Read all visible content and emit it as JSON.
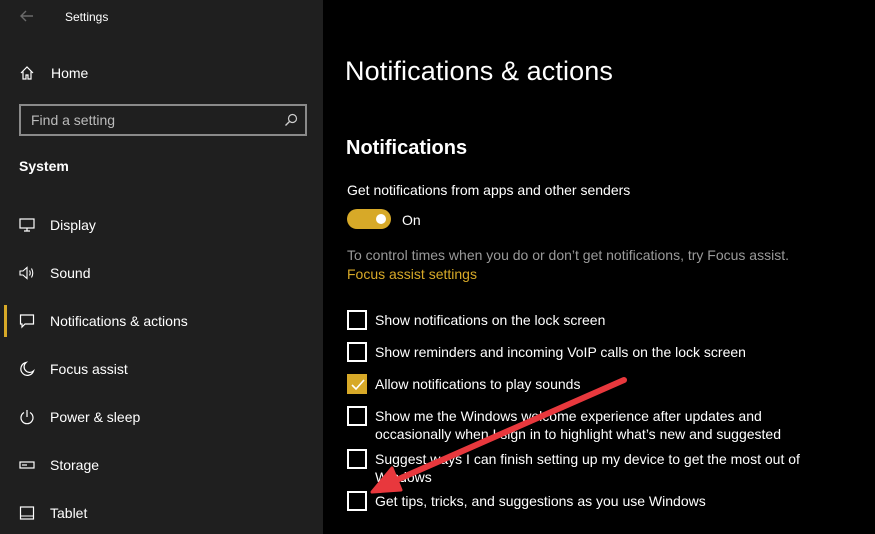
{
  "window": {
    "title": "Settings"
  },
  "sidebar": {
    "home_label": "Home",
    "search_placeholder": "Find a setting",
    "section_label": "System",
    "items": [
      {
        "label": "Display",
        "icon": "monitor-icon"
      },
      {
        "label": "Sound",
        "icon": "speaker-icon"
      },
      {
        "label": "Notifications & actions",
        "icon": "notification-icon",
        "active": true
      },
      {
        "label": "Focus assist",
        "icon": "moon-icon"
      },
      {
        "label": "Power & sleep",
        "icon": "power-icon"
      },
      {
        "label": "Storage",
        "icon": "storage-icon"
      },
      {
        "label": "Tablet",
        "icon": "tablet-icon"
      }
    ]
  },
  "main": {
    "title": "Notifications & actions",
    "section_title": "Notifications",
    "toggle_label": "Get notifications from apps and other senders",
    "toggle_state": "On",
    "help_text": "To control times when you do or don’t get notifications, try Focus assist.",
    "link_text": "Focus assist settings",
    "checkboxes": [
      {
        "label": "Show notifications on the lock screen",
        "checked": false
      },
      {
        "label": "Show reminders and incoming VoIP calls on the lock screen",
        "checked": false
      },
      {
        "label": "Allow notifications to play sounds",
        "checked": true
      },
      {
        "label": "Show me the Windows welcome experience after updates and occasionally when I sign in to highlight what’s new and suggested",
        "checked": false
      },
      {
        "label": "Suggest ways I can finish setting up my device to get the most out of Windows",
        "checked": false
      },
      {
        "label": "Get tips, tricks, and suggestions as you use Windows",
        "checked": false
      }
    ]
  },
  "colors": {
    "accent": "#d7a928",
    "sidebar_bg": "#1f1f1f",
    "main_bg": "#000000",
    "annotation_arrow": "#e8383d"
  }
}
